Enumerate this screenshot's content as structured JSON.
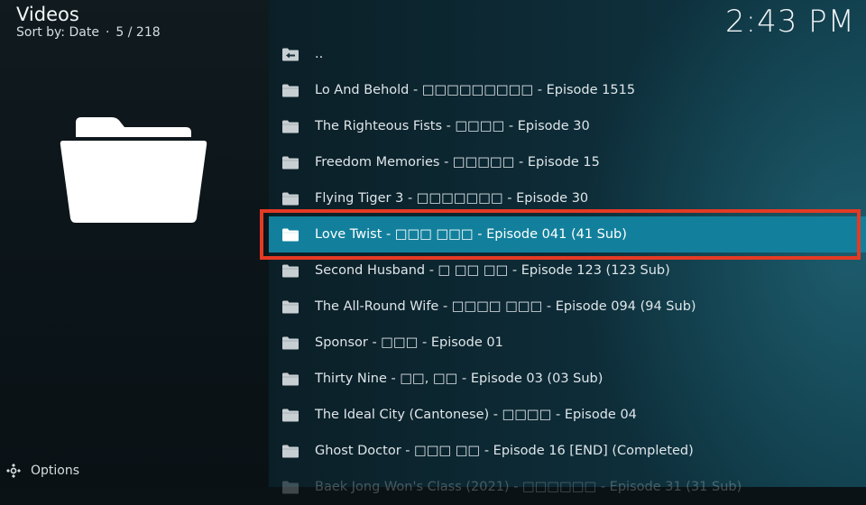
{
  "header": {
    "title": "Videos",
    "sort_label": "Sort by: Date",
    "position": "5 / 218",
    "separator": "·",
    "clock": "2:43 PM"
  },
  "footer": {
    "options_label": "Options"
  },
  "icons": {
    "folder": "folder-icon",
    "parent": "parent-folder-icon",
    "options": "options-icon"
  },
  "colors": {
    "focus": "#12809c",
    "highlight_border": "#e43a24"
  },
  "list": {
    "items": [
      {
        "label": "..",
        "icon": "parent-folder-icon"
      },
      {
        "label": "Lo And Behold - □□□□□□□□□ - Episode 1515",
        "icon": "folder-icon"
      },
      {
        "label": "The Righteous Fists - □□□□ - Episode 30",
        "icon": "folder-icon"
      },
      {
        "label": "Freedom Memories - □□□□□ - Episode 15",
        "icon": "folder-icon"
      },
      {
        "label": "Flying Tiger 3 - □□□□□□□ - Episode 30",
        "icon": "folder-icon"
      },
      {
        "label": "Love Twist - □□□ □□□ - Episode 041 (41 Sub)",
        "icon": "folder-icon",
        "focused": true
      },
      {
        "label": "Second Husband - □ □□ □□ - Episode 123 (123 Sub)",
        "icon": "folder-icon"
      },
      {
        "label": "The All-Round Wife - □□□□ □□□ - Episode 094 (94 Sub)",
        "icon": "folder-icon"
      },
      {
        "label": "Sponsor - □□□ - Episode 01",
        "icon": "folder-icon"
      },
      {
        "label": "Thirty Nine - □□, □□ - Episode 03 (03 Sub)",
        "icon": "folder-icon"
      },
      {
        "label": "The Ideal City (Cantonese) - □□□□ - Episode 04",
        "icon": "folder-icon"
      },
      {
        "label": "Ghost Doctor - □□□ □□ - Episode 16 [END] (Completed)",
        "icon": "folder-icon"
      },
      {
        "label": "Baek Jong Won's Class (2021) - □□□□□□ - Episode 31 (31 Sub)",
        "icon": "folder-icon",
        "faded": true
      }
    ]
  }
}
